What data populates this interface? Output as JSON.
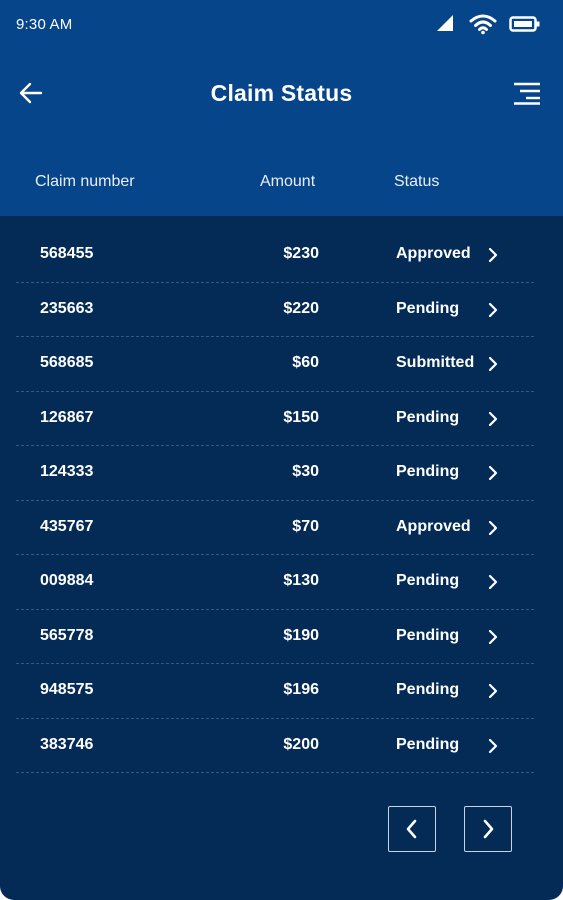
{
  "status_bar": {
    "time": "9:30 AM",
    "icons": [
      "signal-icon",
      "wifi-icon",
      "battery-icon"
    ]
  },
  "app_bar": {
    "title": "Claim Status",
    "back_icon": "arrow-left-icon",
    "menu_icon": "menu-icon"
  },
  "table": {
    "headers": {
      "claim_number": "Claim number",
      "amount": "Amount",
      "status": "Status"
    },
    "rows": [
      {
        "claim": "568455",
        "amount": "$230",
        "status": "Approved"
      },
      {
        "claim": "235663",
        "amount": "$220",
        "status": "Pending"
      },
      {
        "claim": "568685",
        "amount": "$60",
        "status": "Submitted"
      },
      {
        "claim": "126867",
        "amount": "$150",
        "status": "Pending"
      },
      {
        "claim": "124333",
        "amount": "$30",
        "status": "Pending"
      },
      {
        "claim": "435767",
        "amount": "$70",
        "status": "Approved"
      },
      {
        "claim": "009884",
        "amount": "$130",
        "status": "Pending"
      },
      {
        "claim": "565778",
        "amount": "$190",
        "status": "Pending"
      },
      {
        "claim": "948575",
        "amount": "$196",
        "status": "Pending"
      },
      {
        "claim": "383746",
        "amount": "$200",
        "status": "Pending"
      }
    ]
  },
  "pagination": {
    "prev_icon": "chevron-left-icon",
    "next_icon": "chevron-right-icon"
  },
  "colors": {
    "header_bg": "#06458a",
    "body_bg": "#042a56",
    "text": "#ffffff"
  }
}
